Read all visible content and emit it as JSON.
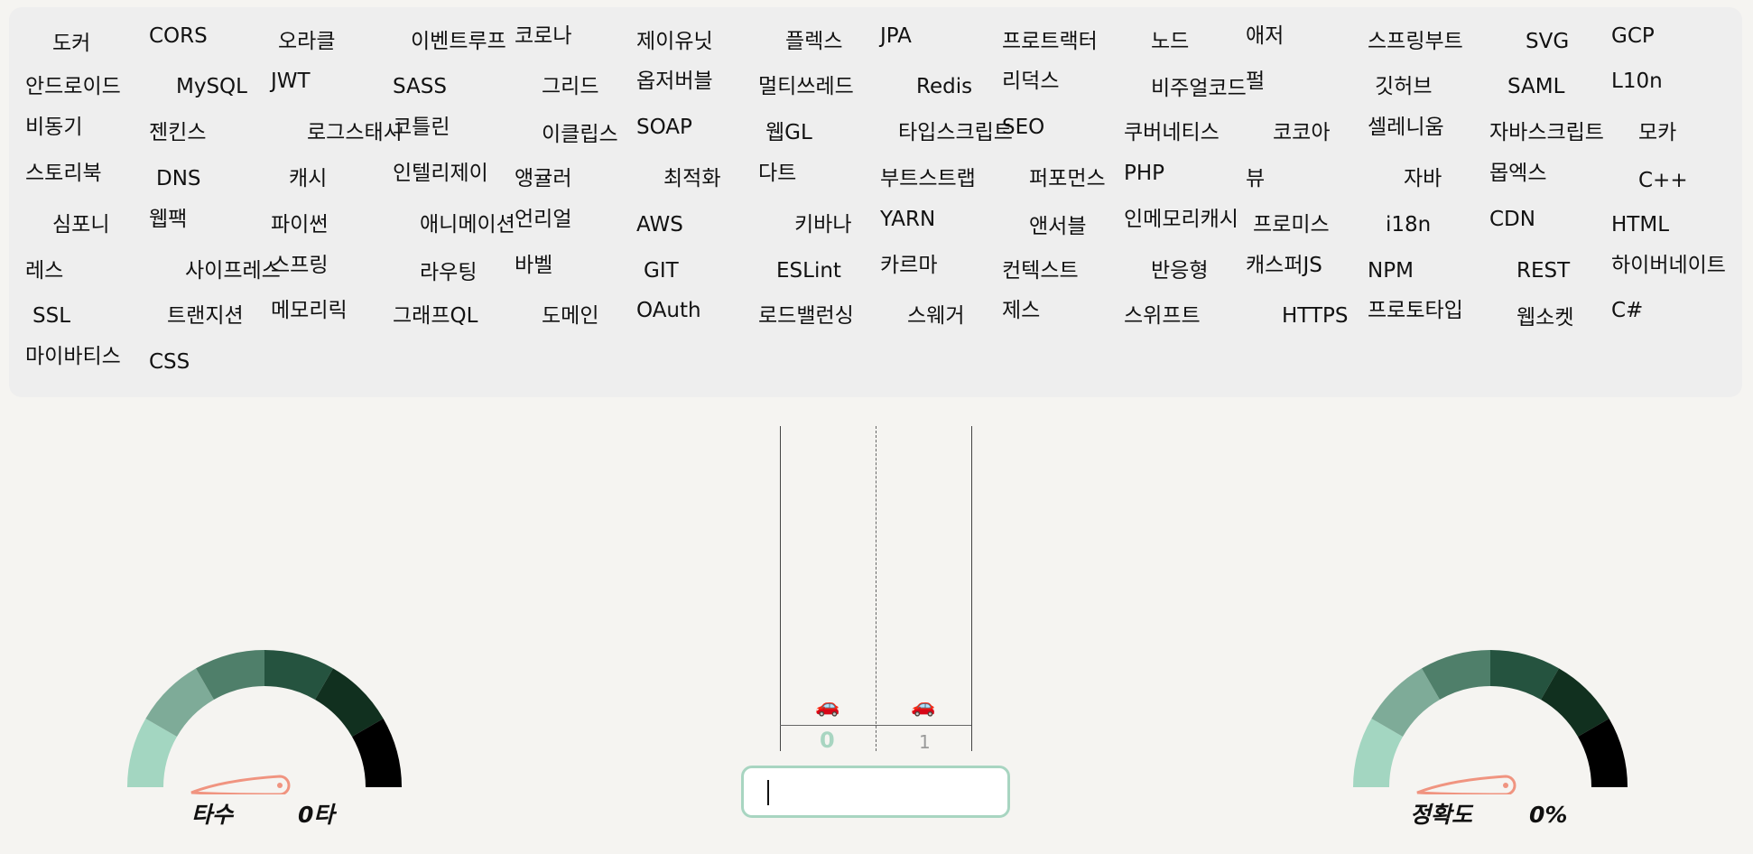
{
  "word_panel": {
    "words": [
      "도커",
      "CORS",
      "오라클",
      "이벤트루프",
      "코로나",
      "제이유닛",
      "플렉스",
      "JPA",
      "프로트랙터",
      "노드",
      "애저",
      "스프링부트",
      "SVG",
      "GCP",
      "안드로이드",
      "MySQL",
      "JWT",
      "SASS",
      "그리드",
      "옵저버블",
      "멀티쓰레드",
      "Redis",
      "리덕스",
      "비주얼코드",
      "펄",
      "깃허브",
      "SAML",
      "L10n",
      "비동기",
      "젠킨스",
      "로그스태시",
      "코틀린",
      "이클립스",
      "SOAP",
      "웹GL",
      "타입스크립트",
      "SEO",
      "쿠버네티스",
      "코코아",
      "셀레니움",
      "자바스크립트",
      "모카",
      "스토리북",
      "DNS",
      "캐시",
      "인텔리제이",
      "앵귤러",
      "최적화",
      "다트",
      "부트스트랩",
      "퍼포먼스",
      "PHP",
      "뷰",
      "자바",
      "몹엑스",
      "C++",
      "심포니",
      "웹팩",
      "파이썬",
      "애니메이션",
      "언리얼",
      "AWS",
      "키바나",
      "YARN",
      "앤서블",
      "인메모리캐시",
      "프로미스",
      "i18n",
      "CDN",
      "HTML",
      "레스",
      "사이프레스",
      "스프링",
      "라우팅",
      "바벨",
      "GIT",
      "ESLint",
      "카르마",
      "컨텍스트",
      "반응형",
      "캐스퍼JS",
      "NPM",
      "REST",
      "하이버네이트",
      "SSL",
      "트랜지션",
      "메모리릭",
      "그래프QL",
      "도메인",
      "OAuth",
      "로드밸런싱",
      "스웨거",
      "제스",
      "스위프트",
      "HTTPS",
      "프로토타입",
      "웹소켓",
      "C#",
      "마이바티스",
      "CSS"
    ]
  },
  "race": {
    "cars": [
      "🚗",
      "🚗"
    ],
    "lanes": [
      "0",
      "1"
    ],
    "car_color": "#d43a2f"
  },
  "typing_input": {
    "value": ""
  },
  "gauges": {
    "speed": {
      "label": "타수",
      "value_text": "0타",
      "value": 0
    },
    "accuracy": {
      "label": "정확도",
      "value_text": "0%",
      "value": 0
    }
  },
  "colors": {
    "gauge_segments": [
      "#a3d6c1",
      "#7eab98",
      "#4f7f6a",
      "#25533f",
      "#11301f",
      "#000000"
    ],
    "needle": "#f09480",
    "input_border": "#a8d5c1",
    "lane_number": "#a8d5c1"
  }
}
